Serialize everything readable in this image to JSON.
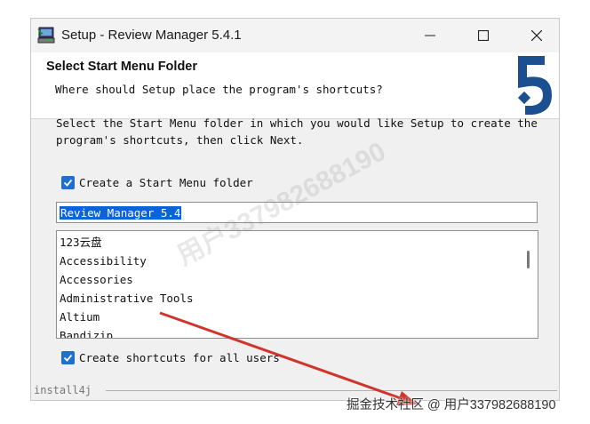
{
  "window": {
    "title": "Setup - Review Manager 5.4.1"
  },
  "header": {
    "title": "Select Start Menu Folder",
    "subtitle": "Where should Setup place the program's shortcuts?",
    "logo_text": "5"
  },
  "body": {
    "description_line1": "Select the Start Menu folder in which you would like Setup to create the",
    "description_line2": "program's shortcuts, then click Next.",
    "create_folder_label": "Create a Start Menu folder",
    "create_folder_checked": true,
    "folder_name_value": "Review Manager 5.4",
    "folder_list": [
      "123云盘",
      "Accessibility",
      "Accessories",
      "Administrative Tools",
      "Altium",
      "Bandizip"
    ],
    "all_users_label": "Create shortcuts for all users",
    "all_users_checked": true
  },
  "footer": {
    "brand": "install4j"
  },
  "overlays": {
    "diagonal_watermark": "用户337982688190",
    "bottom_watermark": "掘金技术社区 @ 用户337982688190",
    "arrow_color": "#d0342c"
  },
  "colors": {
    "accent": "#1f6fd1",
    "selection": "#0a64d8",
    "logo_blue": "#1b4f8f"
  }
}
